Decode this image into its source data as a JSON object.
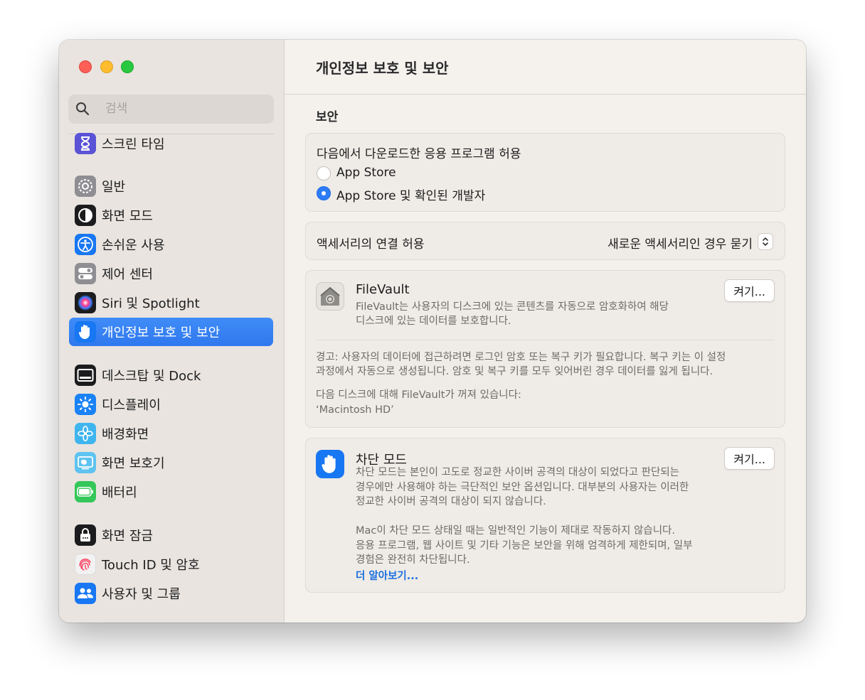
{
  "sidebar": {
    "search_placeholder": "검색",
    "items": [
      {
        "label": "스크린 타임",
        "icon": "hourglass-icon",
        "color": "#5b53d6"
      },
      {
        "label": "일반",
        "icon": "gear-icon",
        "color": "#8e8e93"
      },
      {
        "label": "화면 모드",
        "icon": "appearance-icon",
        "color": "#1c1c1e"
      },
      {
        "label": "손쉬운 사용",
        "icon": "accessibility-icon",
        "color": "#1877f2"
      },
      {
        "label": "제어 센터",
        "icon": "control-center-icon",
        "color": "#8e8e93"
      },
      {
        "label": "Siri 및 Spotlight",
        "icon": "siri-icon",
        "color": "#1c1c1e"
      },
      {
        "label": "개인정보 보호 및 보안",
        "icon": "hand-icon",
        "color": "#1877f2"
      },
      {
        "label": "데스크탑 및 Dock",
        "icon": "dock-icon",
        "color": "#1c1c1e"
      },
      {
        "label": "디스플레이",
        "icon": "brightness-icon",
        "color": "#1a82f7"
      },
      {
        "label": "배경화면",
        "icon": "flower-icon",
        "color": "#3fb5f0"
      },
      {
        "label": "화면 보호기",
        "icon": "screensaver-icon",
        "color": "#5ec3f0"
      },
      {
        "label": "배터리",
        "icon": "battery-icon",
        "color": "#34c759"
      },
      {
        "label": "화면 잠금",
        "icon": "lock-icon",
        "color": "#1c1c1e"
      },
      {
        "label": "Touch ID 및 암호",
        "icon": "fingerprint-icon",
        "color": "#f2f2f2"
      },
      {
        "label": "사용자 및 그룹",
        "icon": "users-icon",
        "color": "#1877f2"
      }
    ],
    "selected_index": 6
  },
  "main": {
    "title": "개인정보 보호 및 보안",
    "section_title": "보안",
    "download": {
      "heading": "다음에서 다운로드한 응용 프로그램 허용",
      "options": [
        "App Store",
        "App Store 및 확인된 개발자"
      ],
      "selected": 1
    },
    "accessory": {
      "label": "액세서리의 연결 허용",
      "value": "새로운 액세서리인 경우 묻기"
    },
    "filevault": {
      "title": "FileVault",
      "desc": [
        "FileVault는 사용자의 디스크에 있는 콘텐츠를 자동으로 암호화하여 해당",
        "디스크에 있는 데이터를 보호합니다."
      ],
      "button": "켜기...",
      "warning": [
        "경고: 사용자의 데이터에 접근하려면 로그인 암호 또는 복구 키가 필요합니다. 복구 키는 이 설정",
        "과정에서 자동으로 생성됩니다. 암호 및 복구 키를 모두 잊어버린 경우 데이터를 잃게 됩니다."
      ],
      "status": [
        "다음 디스크에 대해 FileVault가 꺼져 있습니다:",
        "‘Macintosh HD’"
      ]
    },
    "lockdown": {
      "title": "차단 모드",
      "desc": [
        "차단 모드는 본인이 고도로 정교한 사이버 공격의 대상이 되었다고 판단되는",
        "경우에만 사용해야 하는 극단적인 보안 옵션입니다. 대부분의 사용자는 이러한",
        "정교한 사이버 공격의 대상이 되지 않습니다."
      ],
      "desc2": [
        "Mac이 차단 모드 상태일 때는 일반적인 기능이 제대로 작동하지 않습니다.",
        "응용 프로그램, 웹 사이트 및 기타 기능은 보안을 위해 엄격하게 제한되며, 일부",
        "경험은 완전히 차단됩니다."
      ],
      "link": "더 알아보기...",
      "button": "켜기..."
    }
  },
  "colors": {
    "accent": "#2d7cf6",
    "selection": "#3b82f6",
    "link": "#1a6fe0"
  }
}
